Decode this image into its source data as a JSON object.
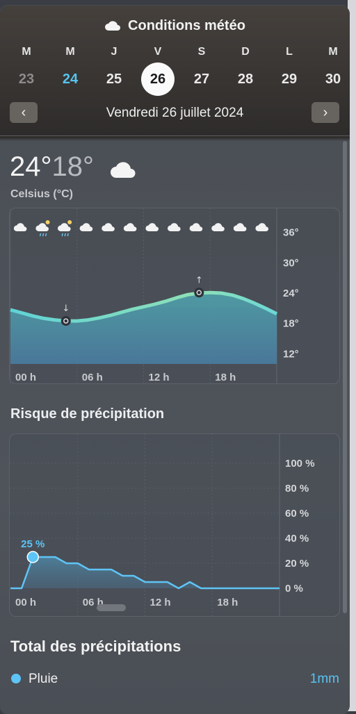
{
  "window": {
    "title": "Conditions météo",
    "title_icon": "cloud-icon"
  },
  "calendar": {
    "weekdays": [
      "M",
      "M",
      "J",
      "V",
      "S",
      "D",
      "L",
      "M"
    ],
    "days": [
      "23",
      "24",
      "25",
      "26",
      "27",
      "28",
      "29",
      "30"
    ],
    "today_index": 1,
    "selected_index": 3,
    "date_label": "Vendredi 26 juillet 2024",
    "prev_icon": "chevron-left-icon",
    "next_icon": "chevron-right-icon"
  },
  "current": {
    "high": "24°",
    "low": "18°",
    "condition_icon": "cloud-icon",
    "units_label": "Celsius (°C)"
  },
  "temperature_chart": {
    "hourly_icons": [
      "cloud-icon",
      "cloud-drizzle-icon",
      "cloud-drizzle-icon",
      "cloud-icon",
      "cloud-icon",
      "cloud-icon",
      "cloud-icon",
      "cloud-icon",
      "cloud-icon",
      "cloud-icon",
      "cloud-icon",
      "cloud-icon"
    ],
    "y_ticks": [
      "36°",
      "30°",
      "24°",
      "18°",
      "12°"
    ],
    "x_ticks": [
      "00 h",
      "06 h",
      "12 h",
      "18 h"
    ]
  },
  "precip_section": {
    "title": "Risque de précipitation"
  },
  "precip_chart": {
    "y_ticks": [
      "100 %",
      "80 %",
      "60 %",
      "40 %",
      "20 %",
      "0 %"
    ],
    "x_ticks": [
      "00 h",
      "06 h",
      "12 h",
      "18 h"
    ],
    "peak_label": "25 %"
  },
  "total_section": {
    "title": "Total des précipitations",
    "legend_label": "Pluie",
    "legend_value": "1mm",
    "legend_color": "#5ec4f5"
  },
  "chart_data": [
    {
      "type": "area",
      "title": "",
      "x_unit": "hour",
      "xlim": [
        0,
        24
      ],
      "ylim": [
        10,
        38
      ],
      "x": [
        0,
        1,
        2,
        3,
        4,
        5,
        6,
        7,
        8,
        9,
        10,
        11,
        12,
        13,
        14,
        15,
        16,
        17,
        18,
        19,
        20,
        21,
        22,
        23,
        24
      ],
      "series": [
        {
          "values": [
            20.7,
            20.1,
            19.5,
            19.0,
            18.7,
            18.5,
            18.5,
            18.7,
            19.1,
            19.6,
            20.2,
            20.8,
            21.3,
            21.8,
            22.4,
            23.1,
            23.7,
            24.0,
            24.1,
            24.0,
            23.6,
            22.9,
            22.0,
            21.0,
            19.9
          ]
        }
      ],
      "min_marker": {
        "x": 5,
        "y": 18.5
      },
      "max_marker": {
        "x": 17,
        "y": 24.1
      }
    },
    {
      "type": "area",
      "title": "Risque de précipitation",
      "x_unit": "hour",
      "xlim": [
        0,
        24
      ],
      "ylim": [
        0,
        100
      ],
      "x": [
        0,
        1,
        2,
        3,
        4,
        5,
        6,
        7,
        8,
        9,
        10,
        11,
        12,
        13,
        14,
        15,
        16,
        17,
        18,
        19,
        20,
        21,
        22,
        23,
        24
      ],
      "series": [
        {
          "values": [
            0,
            0,
            25,
            25,
            25,
            20,
            20,
            15,
            15,
            15,
            10,
            10,
            5,
            5,
            5,
            0,
            5,
            0,
            0,
            0,
            0,
            0,
            0,
            0,
            0
          ]
        }
      ],
      "peak_marker": {
        "x": 2,
        "y": 25
      }
    }
  ]
}
